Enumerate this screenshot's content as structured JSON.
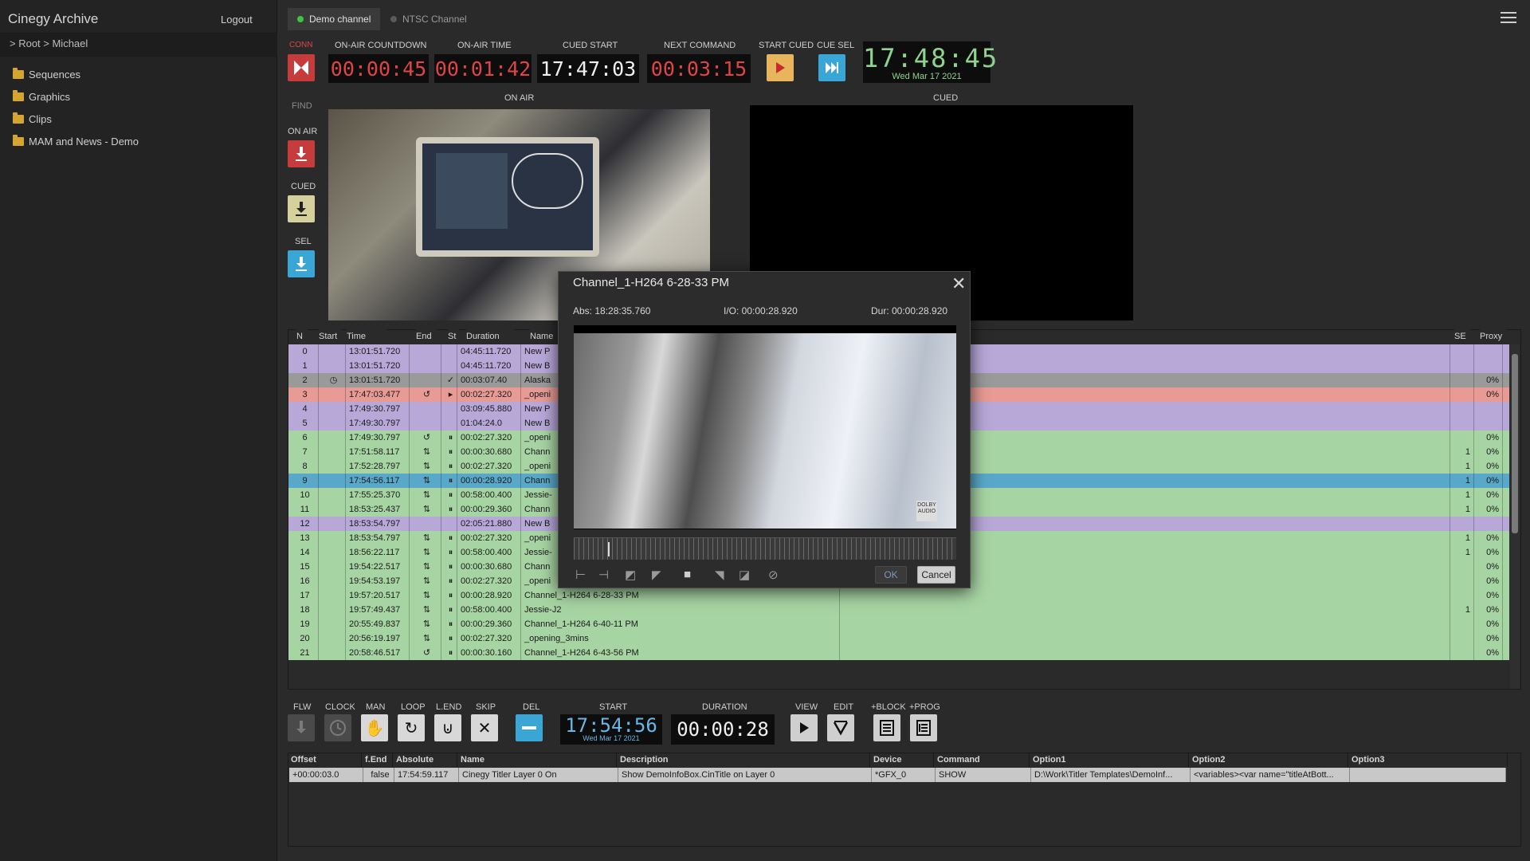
{
  "sidebar": {
    "title": "Cinegy Archive",
    "logout": "Logout",
    "breadcrumb": ">  Root  >  Michael",
    "tree": [
      {
        "label": "Sequences",
        "icon": "folder-icon"
      },
      {
        "label": "Graphics",
        "icon": "folder-icon"
      },
      {
        "label": "Clips",
        "icon": "folder-icon"
      },
      {
        "label": "MAM and News - Demo",
        "icon": "folder-icon"
      }
    ]
  },
  "tabs": [
    {
      "label": "Demo channel",
      "active": true,
      "dot_color": "#3fc63f"
    },
    {
      "label": "NTSC Channel",
      "active": false,
      "dot_color": "#6a6a6a"
    }
  ],
  "top": {
    "conn_label": "CONN",
    "onair_countdown_label": "ON-AIR COUNTDOWN",
    "onair_countdown": "00:00:45",
    "onair_time_label": "ON-AIR TIME",
    "onair_time": "00:01:42",
    "cued_start_label": "CUED START",
    "cued_start": "17:47:03",
    "next_command_label": "NEXT COMMAND",
    "next_command": "00:03:15",
    "start_cued_label": "START CUED",
    "cue_sel_label": "CUE SEL",
    "clock_time": "17:48:45",
    "clock_date": "Wed Mar 17 2021"
  },
  "left_tools": {
    "find": "FIND",
    "on_air": "ON AIR",
    "cued": "CUED",
    "sel": "SEL"
  },
  "preview": {
    "on_air_label": "ON AIR",
    "cued_label": "CUED"
  },
  "playlist": {
    "columns": [
      "N",
      "Start",
      "Time",
      "End",
      "St",
      "Duration",
      "Name",
      "SE",
      "Proxy"
    ],
    "rows": [
      {
        "n": "0",
        "start": "",
        "time": "13:01:51.720",
        "end": "",
        "st": "",
        "dur": "04:45:11.720",
        "name": "New P",
        "se": "",
        "proxy": "",
        "color": "purple"
      },
      {
        "n": "1",
        "start": "",
        "time": "13:01:51.720",
        "end": "",
        "st": "",
        "dur": "04:45:11.720",
        "name": "New B",
        "se": "",
        "proxy": "",
        "color": "purple"
      },
      {
        "n": "2",
        "start": "◷",
        "time": "13:01:51.720",
        "end": "",
        "st": "✓",
        "dur": "00:03:07.40",
        "name": "Alaska",
        "se": "",
        "proxy": "0%",
        "color": "grey"
      },
      {
        "n": "3",
        "start": "",
        "time": "17:47:03.477",
        "end": "↺",
        "st": "▸",
        "dur": "00:02:27.320",
        "name": "_openi",
        "se": "",
        "proxy": "0%",
        "color": "salmon"
      },
      {
        "n": "4",
        "start": "",
        "time": "17:49:30.797",
        "end": "",
        "st": "",
        "dur": "03:09:45.880",
        "name": "New P",
        "se": "",
        "proxy": "",
        "color": "purple"
      },
      {
        "n": "5",
        "start": "",
        "time": "17:49:30.797",
        "end": "",
        "st": "",
        "dur": "01:04:24.0",
        "name": "New B",
        "se": "",
        "proxy": "",
        "color": "purple"
      },
      {
        "n": "6",
        "start": "",
        "time": "17:49:30.797",
        "end": "↺",
        "st": "⏸",
        "dur": "00:02:27.320",
        "name": "_openi",
        "se": "",
        "proxy": "0%",
        "color": "green"
      },
      {
        "n": "7",
        "start": "",
        "time": "17:51:58.117",
        "end": "⇅",
        "st": "⏸",
        "dur": "00:00:30.680",
        "name": "Chann",
        "se": "1",
        "proxy": "0%",
        "color": "green"
      },
      {
        "n": "8",
        "start": "",
        "time": "17:52:28.797",
        "end": "⇅",
        "st": "⏸",
        "dur": "00:02:27.320",
        "name": "_openi",
        "se": "1",
        "proxy": "0%",
        "color": "green"
      },
      {
        "n": "9",
        "start": "",
        "time": "17:54:56.117",
        "end": "⇅",
        "st": "⏸",
        "dur": "00:00:28.920",
        "name": "Chann",
        "se": "1",
        "proxy": "0%",
        "color": "blue"
      },
      {
        "n": "10",
        "start": "",
        "time": "17:55:25.370",
        "end": "⇅",
        "st": "⏸",
        "dur": "00:58:00.400",
        "name": "Jessie-",
        "se": "1",
        "proxy": "0%",
        "color": "green"
      },
      {
        "n": "11",
        "start": "",
        "time": "18:53:25.437",
        "end": "⇅",
        "st": "⏸",
        "dur": "00:00:29.360",
        "name": "Chann",
        "se": "1",
        "proxy": "0%",
        "color": "green"
      },
      {
        "n": "12",
        "start": "",
        "time": "18:53:54.797",
        "end": "",
        "st": "",
        "dur": "02:05:21.880",
        "name": "New B",
        "se": "",
        "proxy": "",
        "color": "purple"
      },
      {
        "n": "13",
        "start": "",
        "time": "18:53:54.797",
        "end": "⇅",
        "st": "⏸",
        "dur": "00:02:27.320",
        "name": "_openi",
        "se": "1",
        "proxy": "0%",
        "color": "green"
      },
      {
        "n": "14",
        "start": "",
        "time": "18:56:22.117",
        "end": "⇅",
        "st": "⏸",
        "dur": "00:58:00.400",
        "name": "Jessie-",
        "se": "1",
        "proxy": "0%",
        "color": "green"
      },
      {
        "n": "15",
        "start": "",
        "time": "19:54:22.517",
        "end": "⇅",
        "st": "⏸",
        "dur": "00:00:30.680",
        "name": "Chann",
        "se": "",
        "proxy": "0%",
        "color": "green"
      },
      {
        "n": "16",
        "start": "",
        "time": "19:54:53.197",
        "end": "⇅",
        "st": "⏸",
        "dur": "00:02:27.320",
        "name": "_openi",
        "se": "",
        "proxy": "0%",
        "color": "green"
      },
      {
        "n": "17",
        "start": "",
        "time": "19:57:20.517",
        "end": "⇅",
        "st": "⏸",
        "dur": "00:00:28.920",
        "name": "Channel_1-H264 6-28-33 PM",
        "se": "",
        "proxy": "0%",
        "color": "green"
      },
      {
        "n": "18",
        "start": "",
        "time": "19:57:49.437",
        "end": "⇅",
        "st": "⏸",
        "dur": "00:58:00.400",
        "name": "Jessie-J2",
        "se": "1",
        "proxy": "0%",
        "color": "green"
      },
      {
        "n": "19",
        "start": "",
        "time": "20:55:49.837",
        "end": "⇅",
        "st": "⏸",
        "dur": "00:00:29.360",
        "name": "Channel_1-H264 6-40-11 PM",
        "se": "",
        "proxy": "0%",
        "color": "green"
      },
      {
        "n": "20",
        "start": "",
        "time": "20:56:19.197",
        "end": "⇅",
        "st": "⏸",
        "dur": "00:02:27.320",
        "name": "_opening_3mins",
        "se": "",
        "proxy": "0%",
        "color": "green"
      },
      {
        "n": "21",
        "start": "",
        "time": "20:58:46.517",
        "end": "↺",
        "st": "⏸",
        "dur": "00:00:30.160",
        "name": "Channel_1-H264 6-43-56 PM",
        "se": "",
        "proxy": "0%",
        "color": "green"
      }
    ]
  },
  "bottom": {
    "labels": {
      "flw": "FLW",
      "clock": "CLOCK",
      "man": "MAN",
      "loop": "LOOP",
      "lend": "L.END",
      "skip": "SKIP",
      "del": "DEL",
      "start": "START",
      "duration": "DURATION",
      "view": "VIEW",
      "edit": "EDIT",
      "block": "+BLOCK",
      "prog": "+PROG"
    },
    "start_time": "17:54:56",
    "start_date": "Wed Mar 17 2021",
    "duration": "00:00:28"
  },
  "commands": {
    "columns": [
      "Offset",
      "f.End",
      "Absolute",
      "Name",
      "Description",
      "Device",
      "Command",
      "Option1",
      "Option2",
      "Option3"
    ],
    "row": [
      "+00:00:03.0",
      "false",
      "17:54:59.117",
      "Cinegy Titler Layer 0 On",
      "Show DemoInfoBox.CinTitle on Layer 0",
      "*GFX_0",
      "SHOW",
      "D:\\Work\\Titler Templates\\DemoInf...",
      "<variables><var name=\"titleAtBott...",
      ""
    ]
  },
  "dialog": {
    "title": "Channel_1-H264 6-28-33 PM",
    "abs": "Abs: 18:28:35.760",
    "io": "I/O: 00:00:28.920",
    "dur": "Dur: 00:00:28.920",
    "dolby": "DOLBY AUDIO",
    "ok": "OK",
    "cancel": "Cancel",
    "timeline_position": 0.09
  }
}
